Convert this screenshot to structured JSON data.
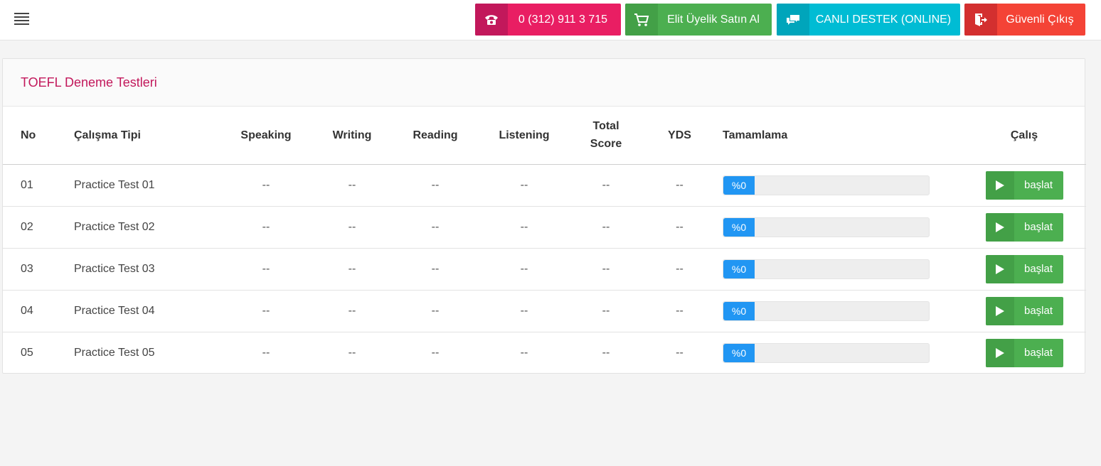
{
  "topbar": {
    "phone_label": "0 (312) 911 3 715",
    "elite_label": "Elit Üyelik Satın Al",
    "live_support_label": "CANLI DESTEK (ONLINE)",
    "logout_label": "Güvenli Çıkış"
  },
  "card": {
    "title": "TOEFL Deneme Testleri"
  },
  "table": {
    "headers": {
      "no": "No",
      "type": "Çalışma Tipi",
      "speaking": "Speaking",
      "writing": "Writing",
      "reading": "Reading",
      "listening": "Listening",
      "total_line1": "Total",
      "total_line2": "Score",
      "yds": "YDS",
      "completion": "Tamamlama",
      "action": "Çalış"
    },
    "rows": [
      {
        "no": "01",
        "type": "Practice Test 01",
        "speaking": "--",
        "writing": "--",
        "reading": "--",
        "listening": "--",
        "total": "--",
        "yds": "--",
        "completion_label": "%0",
        "completion": 0,
        "action": "başlat"
      },
      {
        "no": "02",
        "type": "Practice Test 02",
        "speaking": "--",
        "writing": "--",
        "reading": "--",
        "listening": "--",
        "total": "--",
        "yds": "--",
        "completion_label": "%0",
        "completion": 0,
        "action": "başlat"
      },
      {
        "no": "03",
        "type": "Practice Test 03",
        "speaking": "--",
        "writing": "--",
        "reading": "--",
        "listening": "--",
        "total": "--",
        "yds": "--",
        "completion_label": "%0",
        "completion": 0,
        "action": "başlat"
      },
      {
        "no": "04",
        "type": "Practice Test 04",
        "speaking": "--",
        "writing": "--",
        "reading": "--",
        "listening": "--",
        "total": "--",
        "yds": "--",
        "completion_label": "%0",
        "completion": 0,
        "action": "başlat"
      },
      {
        "no": "05",
        "type": "Practice Test 05",
        "speaking": "--",
        "writing": "--",
        "reading": "--",
        "listening": "--",
        "total": "--",
        "yds": "--",
        "completion_label": "%0",
        "completion": 0,
        "action": "başlat"
      }
    ]
  },
  "icons": {
    "menu": "hamburger-menu-icon",
    "phone": "phone-icon",
    "cart": "shopping-cart-icon",
    "chat": "chat-bubbles-icon",
    "logout": "exit-door-icon",
    "play": "play-icon"
  },
  "colors": {
    "pink": "#e91e63",
    "green": "#4caf50",
    "cyan": "#00bcd4",
    "red": "#f44336",
    "progress_blue": "#2196f3"
  }
}
